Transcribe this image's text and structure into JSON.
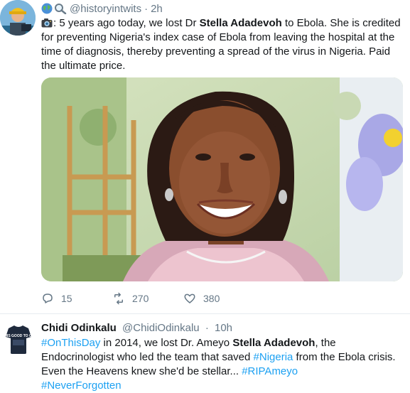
{
  "tweet1": {
    "handle": "@historyintwits",
    "separator": "·",
    "time": "2h",
    "text_parts": [
      ": 5 years ago today, we lost Dr ",
      "Stella Adadevoh",
      " to Ebola. She is credited for preventing Nigeria's index case of Ebola from leaving the hospital at the time of diagnosis, thereby preventing a spread of the virus in Nigeria. Paid the ultimate price."
    ],
    "actions": {
      "replies": "15",
      "retweets": "270",
      "likes": "380"
    }
  },
  "tweet2": {
    "name": "Chidi Odinkalu",
    "handle": "@ChidiOdinkalu",
    "separator": "·",
    "time": "10h",
    "avatar_text": "THIS GOOD TO GO",
    "text_parts": [
      "#OnThisDay",
      " in 2014, we lost Dr. Ameyo ",
      "Stella Adadevoh",
      ", the Endocrinologist who led the team that saved ",
      "#Nigeria",
      " from the Ebola crisis. Even the Heavens knew she'd be stellar... ",
      "#RIPAmeyo",
      "#NeverForgotten"
    ]
  },
  "colors": {
    "link": "#1da1f2",
    "muted": "#657786",
    "text": "#14171a",
    "divider": "#e6ecf0"
  },
  "icons": [
    "globe-icon",
    "magnifying-glass-icon",
    "camera-icon",
    "reply-icon",
    "retweet-icon",
    "like-icon"
  ]
}
